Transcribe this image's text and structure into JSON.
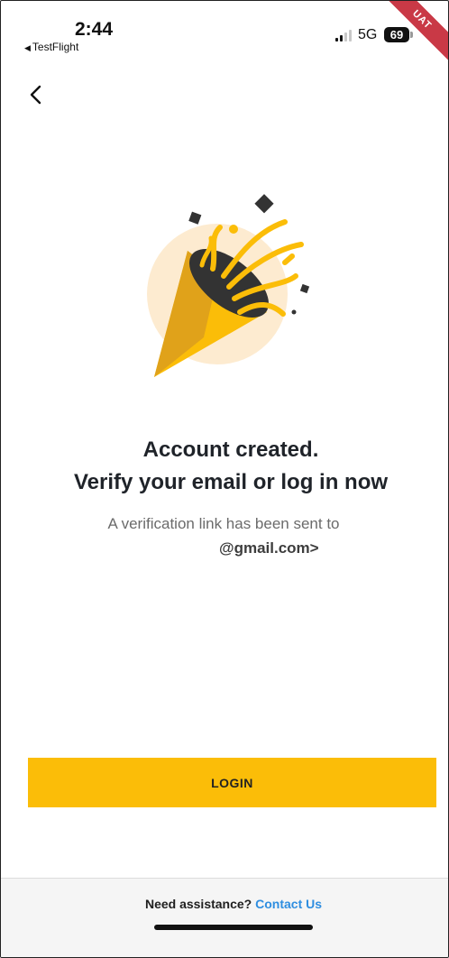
{
  "status_bar": {
    "time": "2:44",
    "back_app": "TestFlight",
    "network": "5G",
    "battery": "69",
    "ribbon": "UAT"
  },
  "icons": {
    "back": "chevron-left-icon",
    "hero": "party-popper-icon"
  },
  "main": {
    "title_line1": "Account created.",
    "title_line2": "Verify your email or log in now",
    "subtitle": "A verification link has been sent to",
    "email": "@gmail.com>"
  },
  "login_button": {
    "label": "LOGIN"
  },
  "footer": {
    "prompt": "Need assistance?",
    "link": "Contact Us"
  },
  "colors": {
    "accent": "#fbbd08",
    "link": "#2f8ee0",
    "ribbon": "#c93946",
    "hero_circle": "#fdebd0",
    "hero_dark": "#333333"
  }
}
